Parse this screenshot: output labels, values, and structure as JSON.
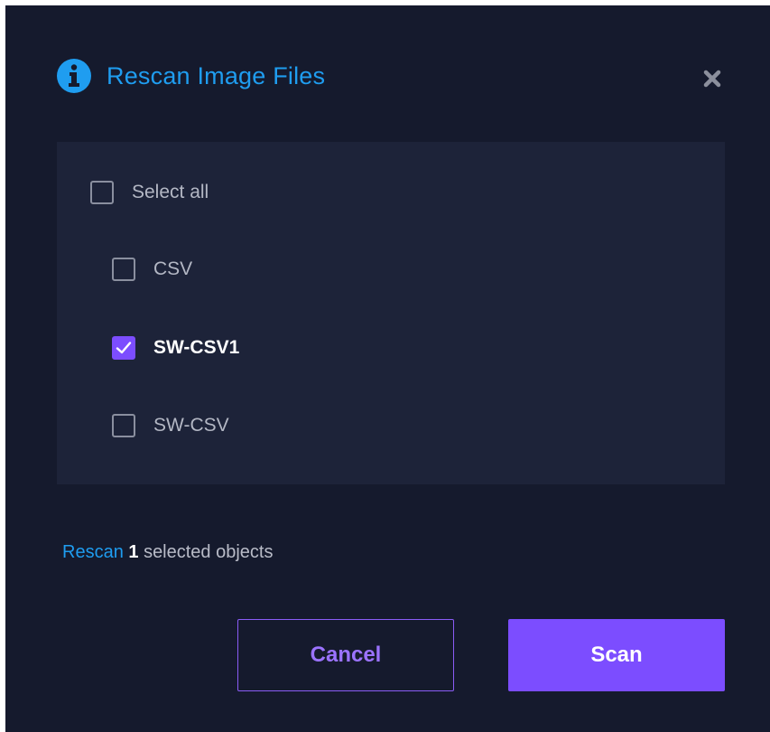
{
  "dialog": {
    "title": "Rescan Image Files",
    "icons": {
      "header": "info-icon",
      "close": "close-icon"
    }
  },
  "list": {
    "select_all_label": "Select all",
    "select_all_checked": false,
    "items": [
      {
        "label": "CSV",
        "checked": false
      },
      {
        "label": "SW-CSV1",
        "checked": true
      },
      {
        "label": "SW-CSV",
        "checked": false
      }
    ]
  },
  "summary": {
    "link_text": "Rescan",
    "count": "1",
    "suffix": "selected objects"
  },
  "buttons": {
    "cancel_label": "Cancel",
    "scan_label": "Scan"
  },
  "colors": {
    "background": "#151a2d",
    "panel": "#1d2339",
    "accent_blue": "#1f9df0",
    "accent_purple": "#7c4dff"
  }
}
